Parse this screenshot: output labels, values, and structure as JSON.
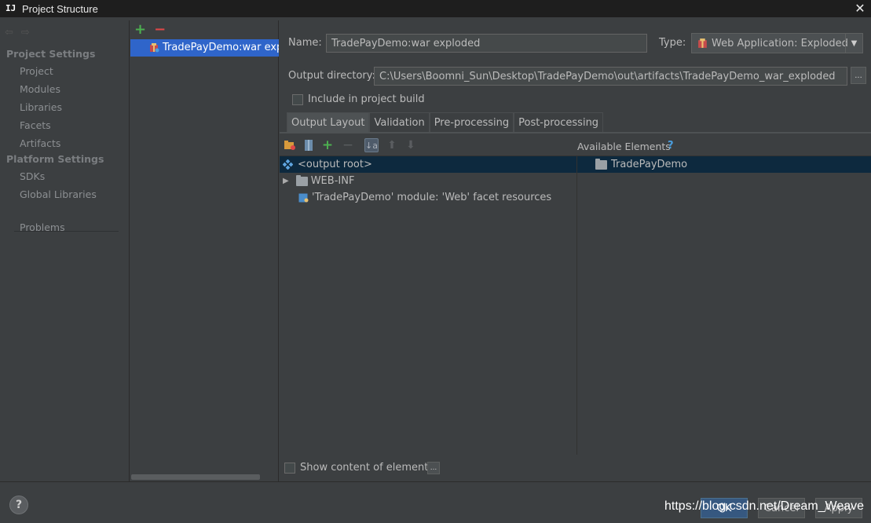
{
  "window": {
    "title": "Project Structure"
  },
  "sidebar": {
    "project_settings_header": "Project Settings",
    "project_items": [
      "Project",
      "Modules",
      "Libraries",
      "Facets",
      "Artifacts"
    ],
    "platform_settings_header": "Platform Settings",
    "platform_items": [
      "SDKs",
      "Global Libraries"
    ],
    "problems": "Problems"
  },
  "artifacts": {
    "selected": "TradePayDemo:war exploded"
  },
  "form": {
    "name_label": "Name:",
    "name_value": "TradePayDemo:war exploded",
    "type_label": "Type:",
    "type_value": "Web Application: Exploded",
    "output_dir_label": "Output directory:",
    "output_dir_value": "C:\\Users\\Boomni_Sun\\Desktop\\TradePayDemo\\out\\artifacts\\TradePayDemo_war_exploded",
    "include_in_build": "Include in project build",
    "include_checked": false
  },
  "tabs": [
    "Output Layout",
    "Validation",
    "Pre-processing",
    "Post-processing"
  ],
  "active_tab": "Output Layout",
  "layout": {
    "available_elements": "Available Elements",
    "help": "?",
    "tree": {
      "root": "<output root>",
      "web_inf": "WEB-INF",
      "facet_resources": "'TradePayDemo' module: 'Web' facet resources"
    },
    "available": {
      "module": "TradePayDemo"
    },
    "show_content": "Show content of elements",
    "show_content_checked": false,
    "ellipsis": "..."
  },
  "footer": {
    "help": "?",
    "ok": "OK",
    "cancel": "Cancel",
    "apply": "Apply",
    "watermark": "https://blog.csdn.net/Dream_Weave"
  },
  "colors": {
    "background": "#3c3f41",
    "selection": "#2f65ca",
    "tree_selection": "#0d293e",
    "add_green": "#4caf50",
    "remove_red": "#e04848"
  }
}
